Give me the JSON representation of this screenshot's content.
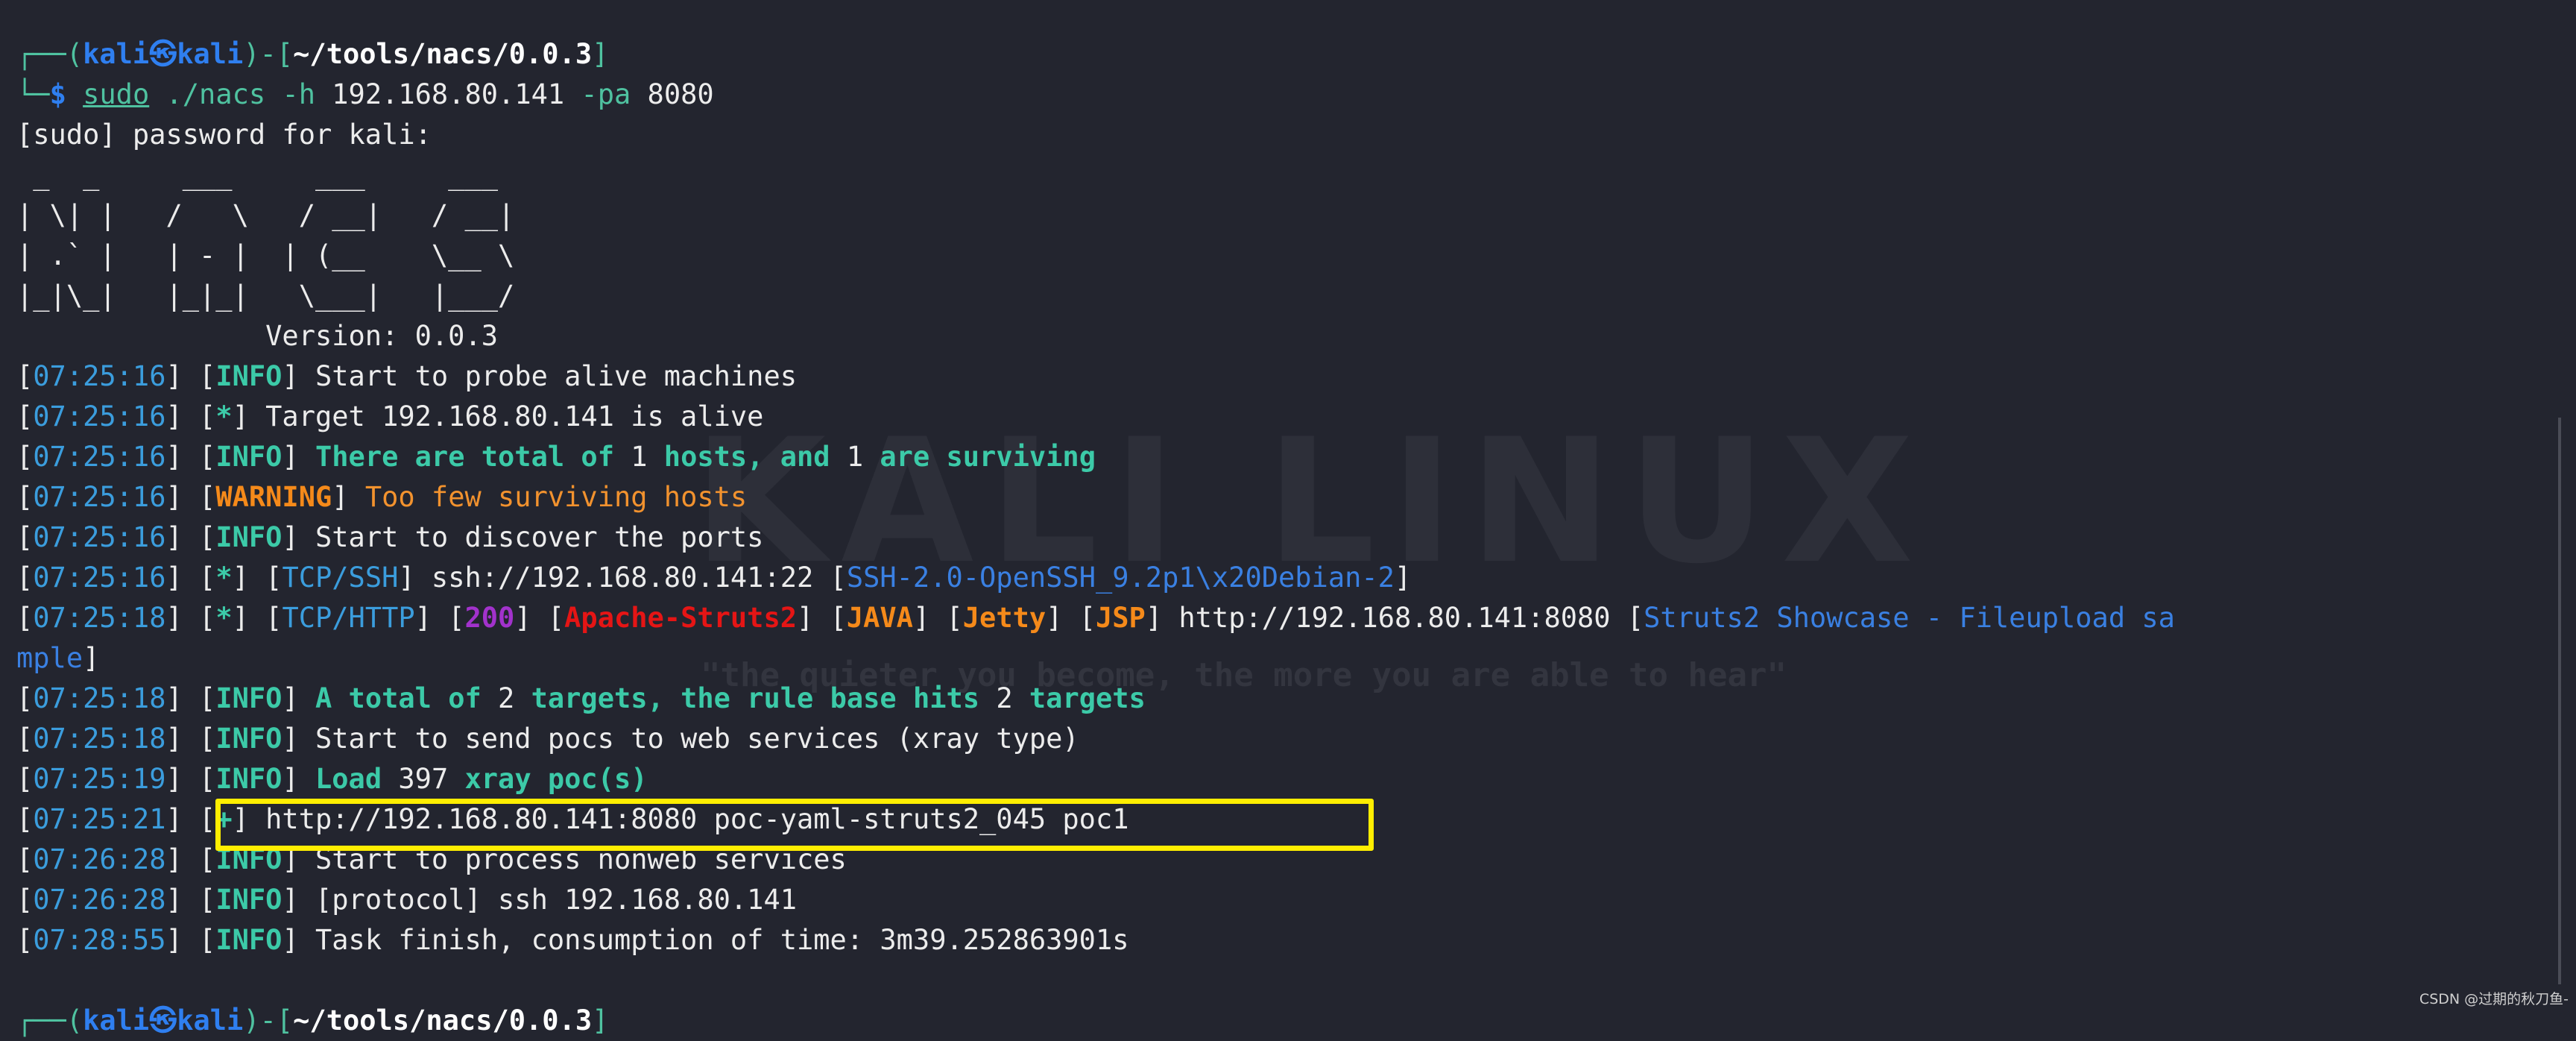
{
  "wallpaper": {
    "logo": "KALI LINUX",
    "quote": "\"the quieter you become, the more you are able to hear\""
  },
  "watermark": "CSDN @过期的秋刀鱼-",
  "colors": {
    "background": "#23252f",
    "highlight": "#ffee00",
    "info": "#3ccaa8",
    "timestamp": "#3b9ddd",
    "warning": "#f58a1a",
    "error_red": "#e51515"
  },
  "lines": [
    {
      "segments": [
        {
          "text": "┌──(",
          "style": "t"
        },
        {
          "text": "kali㉿kali",
          "style": "kb"
        },
        {
          "text": ")-[",
          "style": "t"
        },
        {
          "text": "~/tools/nacs/0.0.3",
          "style": "wb"
        },
        {
          "text": "]",
          "style": "t"
        }
      ]
    },
    {
      "segments": [
        {
          "text": "└─",
          "style": "t"
        },
        {
          "text": "$ ",
          "style": "kb"
        },
        {
          "text": "sudo",
          "style": "tu"
        },
        {
          "text": " ./nacs -h ",
          "style": "t"
        },
        {
          "text": "192.168.80.141",
          "style": "w"
        },
        {
          "text": " -pa ",
          "style": "t"
        },
        {
          "text": "8080",
          "style": "w"
        }
      ]
    },
    {
      "segments": [
        {
          "text": "[sudo] password for kali:",
          "style": "w"
        }
      ]
    },
    {
      "segments": [
        {
          "text": " _  _     ___     ___     ___",
          "style": "w"
        }
      ]
    },
    {
      "segments": [
        {
          "text": "| \\| |   /   \\   / __|   / __|",
          "style": "w"
        }
      ]
    },
    {
      "segments": [
        {
          "text": "| .` |   | - |  | (__    \\__ \\",
          "style": "w"
        }
      ]
    },
    {
      "segments": [
        {
          "text": "|_|\\_|   |_|_|   \\___|   |___/",
          "style": "w"
        }
      ]
    },
    {
      "segments": [
        {
          "text": "               Version: 0.0.3",
          "style": "w"
        }
      ]
    },
    {
      "segments": [
        {
          "text": "[",
          "style": "w"
        },
        {
          "text": "07:25:16",
          "style": "ts"
        },
        {
          "text": "] [",
          "style": "w"
        },
        {
          "text": "INFO",
          "style": "tb"
        },
        {
          "text": "] Start to probe alive machines",
          "style": "w"
        }
      ]
    },
    {
      "segments": [
        {
          "text": "[",
          "style": "w"
        },
        {
          "text": "07:25:16",
          "style": "ts"
        },
        {
          "text": "] [",
          "style": "w"
        },
        {
          "text": "*",
          "style": "tb"
        },
        {
          "text": "] Target 192.168.80.141 is alive",
          "style": "w"
        }
      ]
    },
    {
      "segments": [
        {
          "text": "[",
          "style": "w"
        },
        {
          "text": "07:25:16",
          "style": "ts"
        },
        {
          "text": "] [",
          "style": "w"
        },
        {
          "text": "INFO",
          "style": "tb"
        },
        {
          "text": "] ",
          "style": "w"
        },
        {
          "text": "There are total of ",
          "style": "tb"
        },
        {
          "text": "1",
          "style": "w"
        },
        {
          "text": " hosts, and ",
          "style": "tb"
        },
        {
          "text": "1",
          "style": "w"
        },
        {
          "text": " are surviving",
          "style": "tb"
        }
      ]
    },
    {
      "segments": [
        {
          "text": "[",
          "style": "w"
        },
        {
          "text": "07:25:16",
          "style": "ts"
        },
        {
          "text": "] [",
          "style": "w"
        },
        {
          "text": "WARNING",
          "style": "ob"
        },
        {
          "text": "] ",
          "style": "w"
        },
        {
          "text": "Too few surviving hosts",
          "style": "o"
        }
      ]
    },
    {
      "segments": [
        {
          "text": "[",
          "style": "w"
        },
        {
          "text": "07:25:16",
          "style": "ts"
        },
        {
          "text": "] [",
          "style": "w"
        },
        {
          "text": "INFO",
          "style": "tb"
        },
        {
          "text": "] Start to discover the ports",
          "style": "w"
        }
      ]
    },
    {
      "segments": [
        {
          "text": "[",
          "style": "w"
        },
        {
          "text": "07:25:16",
          "style": "ts"
        },
        {
          "text": "] [",
          "style": "w"
        },
        {
          "text": "*",
          "style": "tb"
        },
        {
          "text": "] [",
          "style": "w"
        },
        {
          "text": "TCP/SSH",
          "style": "ts"
        },
        {
          "text": "] ssh://192.168.80.141:22 [",
          "style": "w"
        },
        {
          "text": "SSH-2.0-OpenSSH_9.2p1\\x20Debian-2",
          "style": "b"
        },
        {
          "text": "]",
          "style": "w"
        }
      ]
    },
    {
      "segments": [
        {
          "text": "[",
          "style": "w"
        },
        {
          "text": "07:25:18",
          "style": "ts"
        },
        {
          "text": "] [",
          "style": "w"
        },
        {
          "text": "*",
          "style": "tb"
        },
        {
          "text": "] [",
          "style": "w"
        },
        {
          "text": "TCP/HTTP",
          "style": "ts"
        },
        {
          "text": "] [",
          "style": "w"
        },
        {
          "text": "200",
          "style": "p"
        },
        {
          "text": "] [",
          "style": "w"
        },
        {
          "text": "Apache-Struts2",
          "style": "r"
        },
        {
          "text": "] [",
          "style": "w"
        },
        {
          "text": "JAVA",
          "style": "ob"
        },
        {
          "text": "] [",
          "style": "w"
        },
        {
          "text": "Jetty",
          "style": "ob"
        },
        {
          "text": "] [",
          "style": "w"
        },
        {
          "text": "JSP",
          "style": "ob"
        },
        {
          "text": "] http://192.168.80.141:8080 [",
          "style": "w"
        },
        {
          "text": "Struts2 Showcase - Fileupload sa",
          "style": "b"
        }
      ]
    },
    {
      "segments": [
        {
          "text": "mple",
          "style": "b"
        },
        {
          "text": "]",
          "style": "w"
        }
      ]
    },
    {
      "segments": [
        {
          "text": "[",
          "style": "w"
        },
        {
          "text": "07:25:18",
          "style": "ts"
        },
        {
          "text": "] [",
          "style": "w"
        },
        {
          "text": "INFO",
          "style": "tb"
        },
        {
          "text": "] ",
          "style": "w"
        },
        {
          "text": "A total of ",
          "style": "tb"
        },
        {
          "text": "2",
          "style": "w"
        },
        {
          "text": " targets, the rule base hits ",
          "style": "tb"
        },
        {
          "text": "2",
          "style": "w"
        },
        {
          "text": " targets",
          "style": "tb"
        }
      ]
    },
    {
      "segments": [
        {
          "text": "[",
          "style": "w"
        },
        {
          "text": "07:25:18",
          "style": "ts"
        },
        {
          "text": "] [",
          "style": "w"
        },
        {
          "text": "INFO",
          "style": "tb"
        },
        {
          "text": "] Start to send pocs to web services (xray type)",
          "style": "w"
        }
      ]
    },
    {
      "segments": [
        {
          "text": "[",
          "style": "w"
        },
        {
          "text": "07:25:19",
          "style": "ts"
        },
        {
          "text": "] [",
          "style": "w"
        },
        {
          "text": "INFO",
          "style": "tb"
        },
        {
          "text": "] ",
          "style": "w"
        },
        {
          "text": "Load ",
          "style": "tb"
        },
        {
          "text": "397",
          "style": "w"
        },
        {
          "text": " xray poc(s)",
          "style": "tb"
        }
      ]
    },
    {
      "segments": [
        {
          "text": "[",
          "style": "w"
        },
        {
          "text": "07:25:21",
          "style": "ts"
        },
        {
          "text": "] [",
          "style": "w"
        },
        {
          "text": "+",
          "style": "tb"
        },
        {
          "text": "] http://192.168.80.141:8080 poc-yaml-struts2_045 poc1",
          "style": "w"
        }
      ]
    },
    {
      "segments": [
        {
          "text": "[",
          "style": "w"
        },
        {
          "text": "07:26:28",
          "style": "ts"
        },
        {
          "text": "] [",
          "style": "w"
        },
        {
          "text": "INFO",
          "style": "tb"
        },
        {
          "text": "] Start to process nonweb services",
          "style": "w"
        }
      ]
    },
    {
      "segments": [
        {
          "text": "[",
          "style": "w"
        },
        {
          "text": "07:26:28",
          "style": "ts"
        },
        {
          "text": "] [",
          "style": "w"
        },
        {
          "text": "INFO",
          "style": "tb"
        },
        {
          "text": "] [protocol] ssh 192.168.80.141",
          "style": "w"
        }
      ]
    },
    {
      "segments": [
        {
          "text": "[",
          "style": "w"
        },
        {
          "text": "07:28:55",
          "style": "ts"
        },
        {
          "text": "] [",
          "style": "w"
        },
        {
          "text": "INFO",
          "style": "tb"
        },
        {
          "text": "] Task finish, consumption of time: 3m39.252863901s",
          "style": "w"
        }
      ]
    },
    {
      "segments": [
        {
          "text": "",
          "style": "w"
        }
      ]
    },
    {
      "segments": [
        {
          "text": "┌──(",
          "style": "t"
        },
        {
          "text": "kali㉿kali",
          "style": "kb"
        },
        {
          "text": ")-[",
          "style": "t"
        },
        {
          "text": "~/tools/nacs/0.0.3",
          "style": "wb"
        },
        {
          "text": "]",
          "style": "t"
        }
      ]
    }
  ]
}
